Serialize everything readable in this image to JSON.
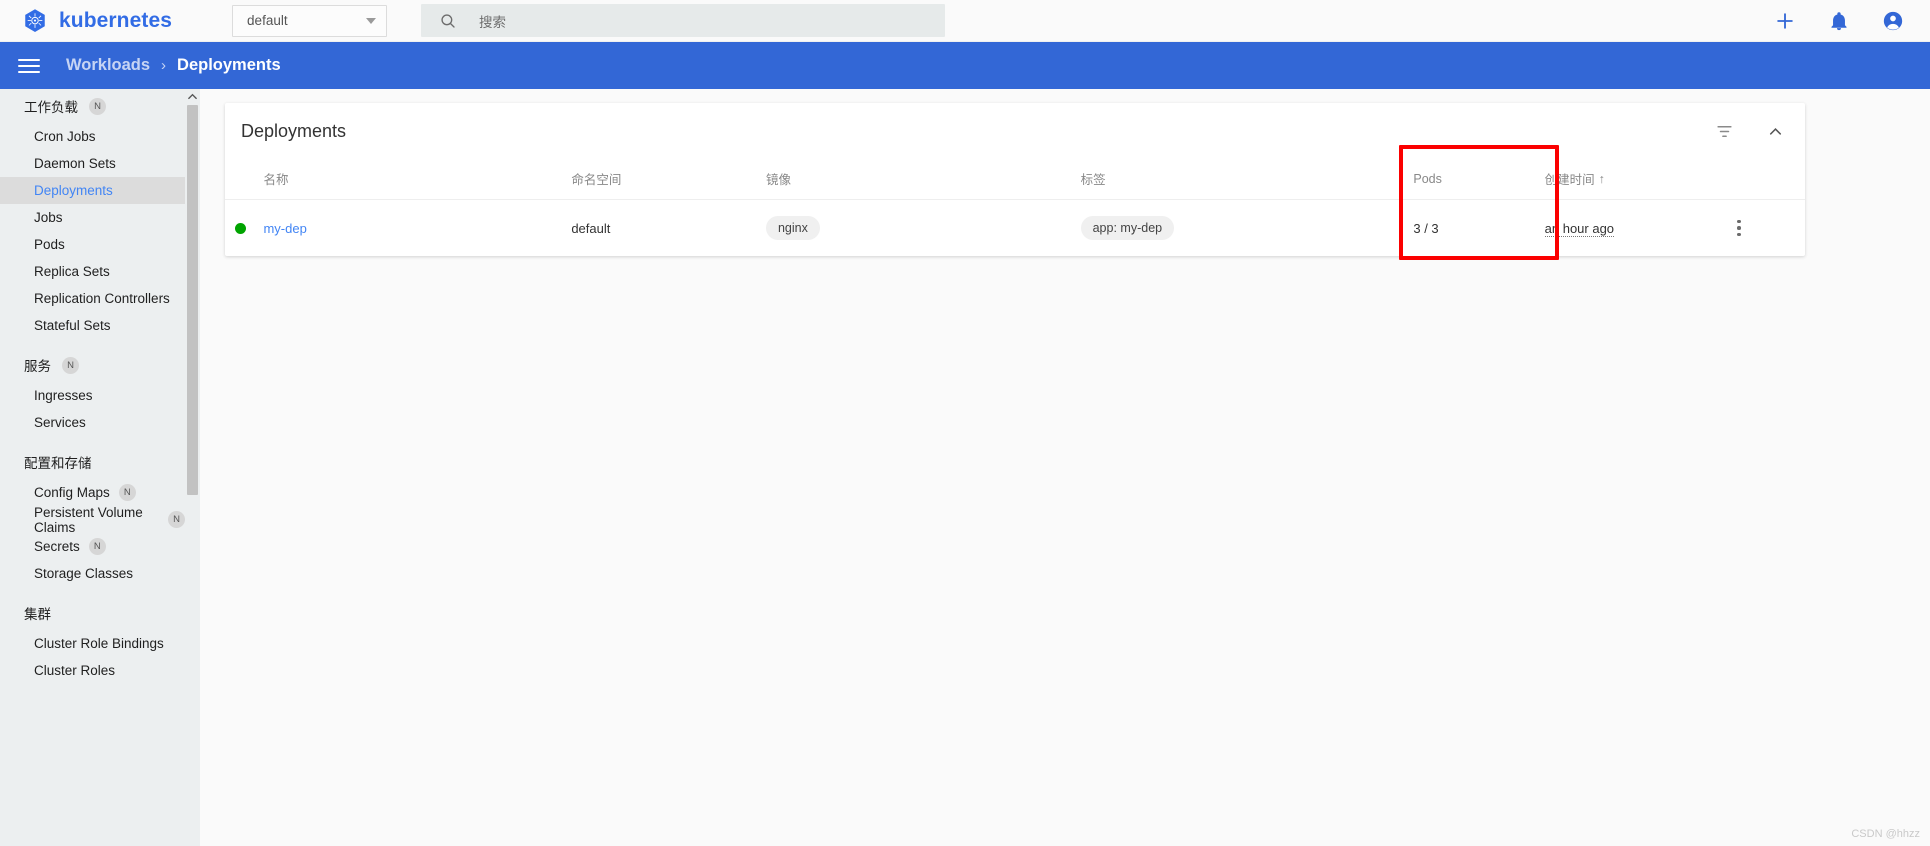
{
  "appbar": {
    "brand": "kubernetes",
    "namespace_selector": {
      "value": "default",
      "icon": "chevron-down-icon"
    },
    "search": {
      "placeholder": "搜索",
      "icon": "search-icon"
    },
    "actions": [
      {
        "name": "create-button",
        "icon": "plus-icon"
      },
      {
        "name": "notifications-button",
        "icon": "bell-icon"
      },
      {
        "name": "account-button",
        "icon": "account-circle-icon"
      }
    ],
    "accent_color": "#326ce5"
  },
  "breadcrumb": {
    "menu_icon": "hamburger-icon",
    "parent": "Workloads",
    "separator": "›",
    "current": "Deployments",
    "bar_color": "#3367d6"
  },
  "sidebar": {
    "groups": [
      {
        "title": "工作负载",
        "badge": "N",
        "items": [
          {
            "label": "Cron Jobs",
            "badge": "",
            "active": false
          },
          {
            "label": "Daemon Sets",
            "badge": "",
            "active": false
          },
          {
            "label": "Deployments",
            "badge": "",
            "active": true
          },
          {
            "label": "Jobs",
            "badge": "",
            "active": false
          },
          {
            "label": "Pods",
            "badge": "",
            "active": false
          },
          {
            "label": "Replica Sets",
            "badge": "",
            "active": false
          },
          {
            "label": "Replication Controllers",
            "badge": "",
            "active": false
          },
          {
            "label": "Stateful Sets",
            "badge": "",
            "active": false
          }
        ]
      },
      {
        "title": "服务",
        "badge": "N",
        "items": [
          {
            "label": "Ingresses",
            "badge": "",
            "active": false
          },
          {
            "label": "Services",
            "badge": "",
            "active": false
          }
        ]
      },
      {
        "title": "配置和存储",
        "badge": "",
        "items": [
          {
            "label": "Config Maps",
            "badge": "N",
            "active": false
          },
          {
            "label": "Persistent Volume Claims",
            "badge": "N",
            "active": false
          },
          {
            "label": "Secrets",
            "badge": "N",
            "active": false
          },
          {
            "label": "Storage Classes",
            "badge": "",
            "active": false
          }
        ]
      },
      {
        "title": "集群",
        "badge": "",
        "items": [
          {
            "label": "Cluster Role Bindings",
            "badge": "",
            "active": false
          },
          {
            "label": "Cluster Roles",
            "badge": "",
            "active": false
          }
        ]
      }
    ],
    "scrollbar": {
      "up_icon": "chevron-up-icon"
    }
  },
  "card": {
    "title": "Deployments",
    "actions": [
      {
        "name": "filter-button",
        "icon": "filter-icon"
      },
      {
        "name": "collapse-button",
        "icon": "chevron-up-icon"
      }
    ],
    "table": {
      "headers": {
        "status": "",
        "name": "名称",
        "namespace": "命名空间",
        "image": "镜像",
        "labels": "标签",
        "pods": "Pods",
        "created": "创建时间",
        "sort_indicator": "↑",
        "menu": ""
      },
      "rows": [
        {
          "status": "running",
          "name": "my-dep",
          "namespace": "default",
          "image": "nginx",
          "labels": "app: my-dep",
          "pods": "3 / 3",
          "created": "an hour ago",
          "menu_icon": "more-vert-icon"
        }
      ]
    }
  },
  "annotation": {
    "target": "pods-column",
    "color": "#fb0000"
  },
  "watermark": "CSDN @hhzz"
}
